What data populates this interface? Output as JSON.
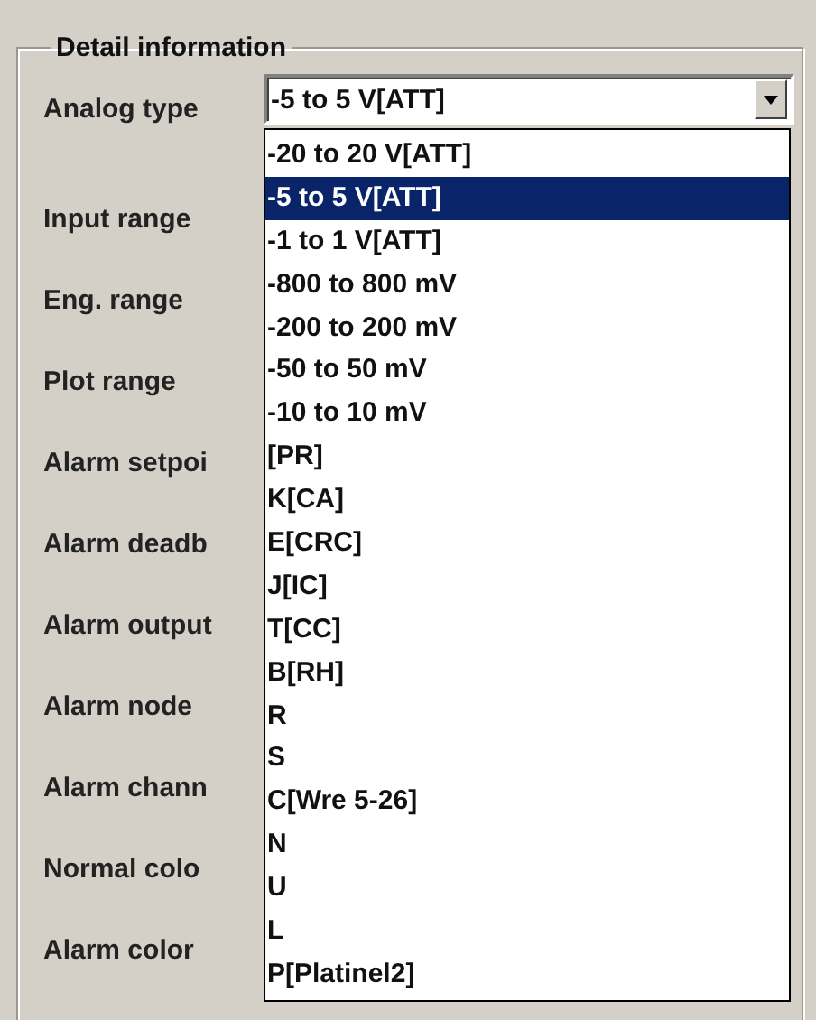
{
  "group": {
    "title": "Detail information"
  },
  "analog_type": {
    "label": "Analog type",
    "value": "-5 to 5 V[ATT]",
    "expanded": true
  },
  "options": [
    {
      "label": "-20 to 20 V[ATT]",
      "selected": false
    },
    {
      "label": "-5 to 5 V[ATT]",
      "selected": true
    },
    {
      "label": "-1 to 1 V[ATT]",
      "selected": false
    },
    {
      "label": "-800 to 800 mV",
      "selected": false
    },
    {
      "label": "-200 to 200 mV",
      "selected": false
    },
    {
      "label": "-50 to 50 mV",
      "selected": false
    },
    {
      "label": "-10 to 10 mV",
      "selected": false
    },
    {
      "label": "[PR]",
      "selected": false
    },
    {
      "label": "K[CA]",
      "selected": false
    },
    {
      "label": "E[CRC]",
      "selected": false
    },
    {
      "label": "J[IC]",
      "selected": false
    },
    {
      "label": "T[CC]",
      "selected": false
    },
    {
      "label": "B[RH]",
      "selected": false
    },
    {
      "label": "R",
      "selected": false
    },
    {
      "label": "S",
      "selected": false
    },
    {
      "label": "C[Wre 5-26]",
      "selected": false
    },
    {
      "label": "N",
      "selected": false
    },
    {
      "label": "U",
      "selected": false
    },
    {
      "label": "L",
      "selected": false
    },
    {
      "label": "P[Platinel2]",
      "selected": false
    }
  ],
  "field_labels": [
    "Input range",
    "Eng. range",
    "Plot range",
    "Alarm setpoi",
    "Alarm deadb",
    "Alarm output",
    "Alarm node",
    "Alarm chann",
    "Normal colo",
    "Alarm color"
  ]
}
